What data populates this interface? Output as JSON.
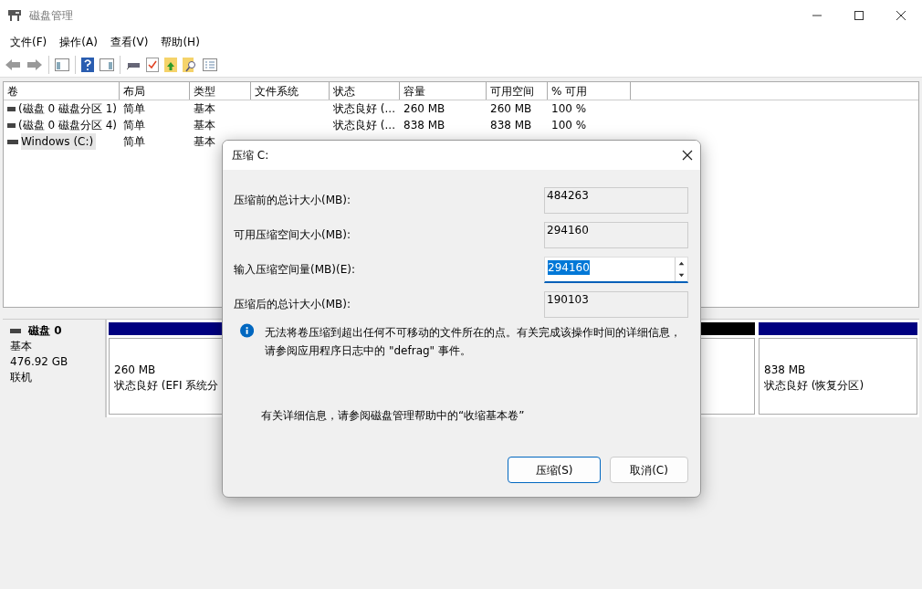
{
  "window": {
    "title": "磁盘管理"
  },
  "menu": [
    "文件(F)",
    "操作(A)",
    "查看(V)",
    "帮助(H)"
  ],
  "table": {
    "columns": [
      "卷",
      "布局",
      "类型",
      "文件系统",
      "状态",
      "容量",
      "可用空间",
      "% 可用"
    ],
    "rows": [
      {
        "cells": [
          "(磁盘 0 磁盘分区 1)",
          "简单",
          "基本",
          "",
          "状态良好 (...",
          "260 MB",
          "260 MB",
          "100 %"
        ],
        "selected": false
      },
      {
        "cells": [
          "(磁盘 0 磁盘分区 4)",
          "简单",
          "基本",
          "",
          "状态良好 (...",
          "838 MB",
          "838 MB",
          "100 %"
        ],
        "selected": false
      },
      {
        "cells": [
          "Windows (C:)",
          "简单",
          "基本"
        ],
        "selected": true
      }
    ]
  },
  "disk": {
    "name": "磁盘 0",
    "type": "基本",
    "size": "476.92 GB",
    "status": "联机",
    "partitions": [
      {
        "color": "#000080",
        "size": "260 MB",
        "status": "状态良好 (EFI 系统分"
      },
      {
        "color": "#000000"
      },
      {
        "color": "#000080",
        "size": "838 MB",
        "status": "状态良好 (恢复分区)"
      }
    ]
  },
  "dialog": {
    "title": "压缩 C:",
    "fields": [
      {
        "kind": "readonly",
        "label": "压缩前的总计大小(MB):",
        "value": "484263"
      },
      {
        "kind": "readonly",
        "label": "可用压缩空间大小(MB):",
        "value": "294160"
      },
      {
        "kind": "spin",
        "label": "输入压缩空间量(MB)(E):",
        "value": "294160"
      },
      {
        "kind": "readonly",
        "label": "压缩后的总计大小(MB):",
        "value": "190103"
      }
    ],
    "info": "无法将卷压缩到超出任何不可移动的文件所在的点。有关完成该操作时间的详细信息，请参阅应用程序日志中的 \"defrag\" 事件。",
    "help": "有关详细信息，请参阅磁盘管理帮助中的“收缩基本卷”",
    "buttons": [
      {
        "label": "压缩(S)",
        "default": true
      },
      {
        "label": "取消(C)",
        "default": false
      }
    ]
  }
}
